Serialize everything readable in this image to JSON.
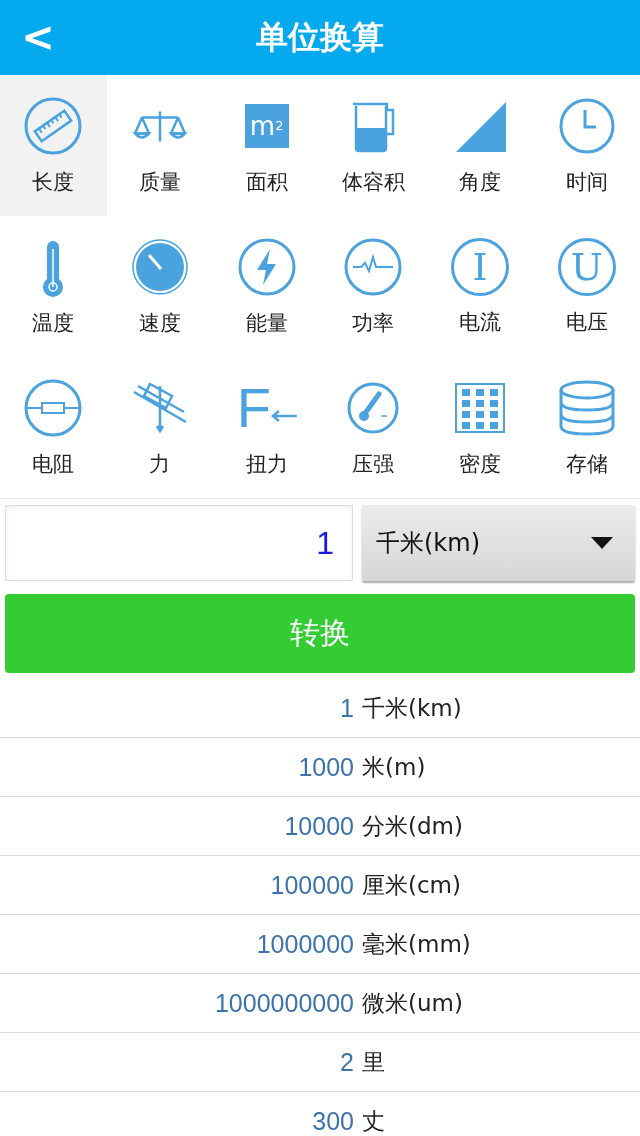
{
  "header": {
    "back": "<",
    "title": "单位换算"
  },
  "categories": [
    {
      "label": "长度",
      "selected": true
    },
    {
      "label": "质量",
      "selected": false
    },
    {
      "label": "面积",
      "kind": "text-square",
      "glyph": "m$^{2}$",
      "selected": false
    },
    {
      "label": "体容积",
      "selected": false
    },
    {
      "label": "角度",
      "selected": false
    },
    {
      "label": "时间",
      "selected": false
    },
    {
      "label": "温度",
      "selected": false
    },
    {
      "label": "速度",
      "selected": false
    },
    {
      "label": "能量",
      "selected": false
    },
    {
      "label": "功率",
      "selected": false
    },
    {
      "label": "电流",
      "kind": "text-circle",
      "glyph": "I",
      "selected": false
    },
    {
      "label": "电压",
      "kind": "text-circle",
      "glyph": "U",
      "selected": false
    },
    {
      "label": "电阻",
      "selected": false
    },
    {
      "label": "力",
      "selected": false
    },
    {
      "label": "扭力",
      "kind": "text-arrow",
      "glyph": "F",
      "selected": false
    },
    {
      "label": "压强",
      "selected": false
    },
    {
      "label": "密度",
      "selected": false
    },
    {
      "label": "存储",
      "selected": false
    }
  ],
  "input": {
    "value": "1"
  },
  "unit_select": {
    "value": "千米(km)"
  },
  "convert_button": "转换",
  "results": [
    {
      "value": "1",
      "unit": "千米(km)"
    },
    {
      "value": "1000",
      "unit": "米(m)"
    },
    {
      "value": "10000",
      "unit": "分米(dm)"
    },
    {
      "value": "100000",
      "unit": "厘米(cm)"
    },
    {
      "value": "1000000",
      "unit": "毫米(mm)"
    },
    {
      "value": "1000000000",
      "unit": "微米(um)"
    },
    {
      "value": "2",
      "unit": "里"
    },
    {
      "value": "300",
      "unit": "丈"
    }
  ]
}
